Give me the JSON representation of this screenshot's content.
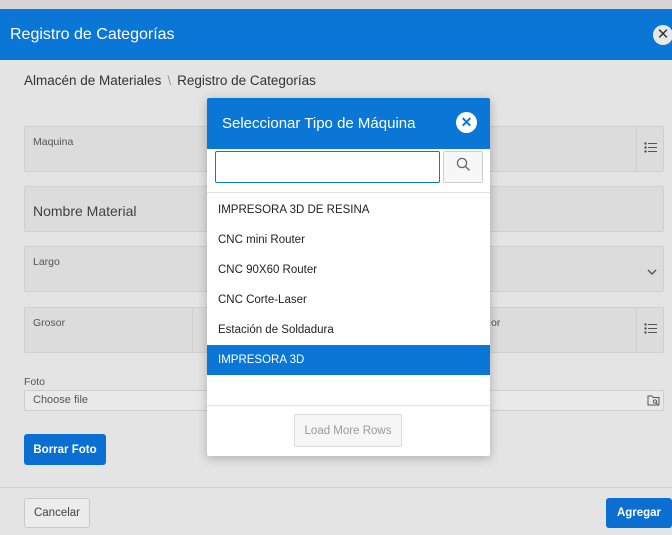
{
  "dialog": {
    "title": "Registro de Categorías",
    "close_glyph": "✕",
    "breadcrumb": [
      "Almacén de Materiales",
      "Registro de Categorías"
    ],
    "breadcrumb_separator": "\\",
    "accent_color": "#0a76d6"
  },
  "form": {
    "maquina_label": "Maquina",
    "nombre_label": "Nombre Material",
    "largo_label": "Largo",
    "grosor_label": "Grosor",
    "grosor_right_label": "or",
    "foto_label": "Foto",
    "file_placeholder": "Choose file",
    "borrar_foto": "Borrar Foto"
  },
  "footer": {
    "cancel": "Cancelar",
    "add": "Agregar"
  },
  "popup": {
    "title": "Seleccionar Tipo de Máquina",
    "search_value": "",
    "items": [
      "IMPRESORA 3D DE RESINA",
      "CNC mini Router",
      "CNC 90X60 Router",
      "CNC Corte-Laser",
      "Estación de Soldadura",
      "IMPRESORA 3D"
    ],
    "selected_index": 5,
    "load_more": "Load More Rows"
  }
}
